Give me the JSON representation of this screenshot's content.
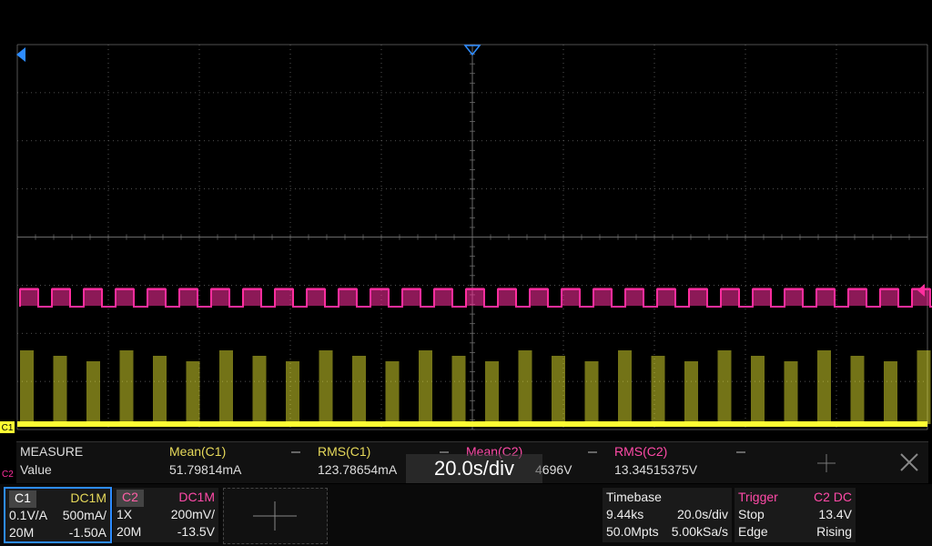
{
  "colors": {
    "ch1": "#ffff33",
    "ch2": "#ff2e9e",
    "trigger_marker": "#2d8cff",
    "grid": "#6a6a6a"
  },
  "markers": {
    "ch1_label": "C1",
    "ch2_label": "C2"
  },
  "measure": {
    "title": "MEASURE",
    "value_label": "Value",
    "items": [
      {
        "label": "Mean(C1)",
        "value": "51.79814mA",
        "color": "#e6d95a"
      },
      {
        "label": "RMS(C1)",
        "value": "123.78654mA",
        "color": "#e6d95a"
      },
      {
        "label": "Mean(C2)",
        "value": "",
        "color": "#ff4aa8"
      },
      {
        "label": "RMS(C2)",
        "value": "13.34515375V",
        "color": "#ff4aa8"
      }
    ],
    "overlay_tail": "4696V"
  },
  "toast": "20.0s/div",
  "channels": [
    {
      "name": "C1",
      "coupling": "DC1M",
      "probe": "0.1V/A",
      "scale": "500mA/",
      "bw": "20M",
      "offset": "-1.50A"
    },
    {
      "name": "C2",
      "coupling": "DC1M",
      "probe": "1X",
      "scale": "200mV/",
      "bw": "20M",
      "offset": "-13.5V"
    }
  ],
  "timebase": {
    "title": "Timebase",
    "delay": "9.44ks",
    "scale": "20.0s/div",
    "points": "50.0Mpts",
    "rate": "5.00kSa/s"
  },
  "trigger": {
    "title": "Trigger",
    "source": "C2 DC",
    "mode": "Stop",
    "level": "13.4V",
    "type": "Edge",
    "slope": "Rising"
  }
}
